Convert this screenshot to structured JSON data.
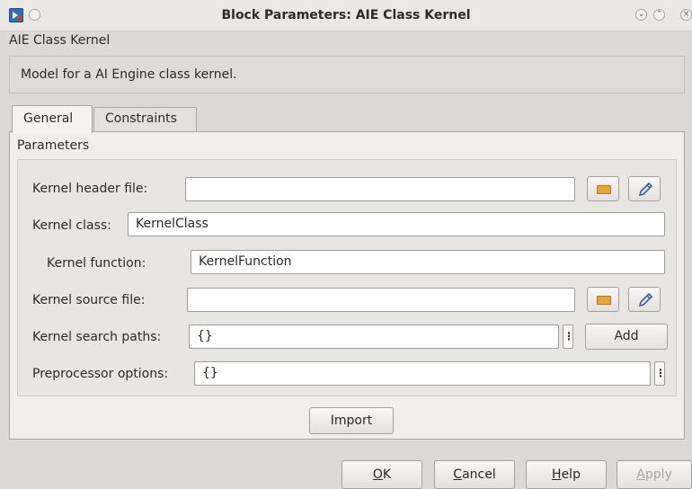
{
  "window": {
    "title": "Block Parameters: AIE Class Kernel"
  },
  "header": {
    "block_name": "AIE Class Kernel",
    "description": "Model for a AI Engine class kernel."
  },
  "tabs": [
    {
      "label": "General",
      "selected": true
    },
    {
      "label": "Constraints",
      "selected": false
    }
  ],
  "parameters": {
    "group_label": "Parameters",
    "kernel_header_file": {
      "label": "Kernel header file:",
      "value": ""
    },
    "kernel_class": {
      "label": "Kernel class:",
      "value": "KernelClass"
    },
    "kernel_function": {
      "label": "Kernel function:",
      "value": "KernelFunction"
    },
    "kernel_source_file": {
      "label": "Kernel source file:",
      "value": ""
    },
    "kernel_search_paths": {
      "label": "Kernel search paths:",
      "value": "{}"
    },
    "preprocessor_options": {
      "label": "Preprocessor options:",
      "value": "{}"
    },
    "add_label": "Add",
    "import_label": "Import",
    "more_glyph": "⋮"
  },
  "footer": {
    "ok": {
      "mnemonic": "O",
      "rest": "K"
    },
    "cancel": {
      "mnemonic": "C",
      "rest": "ancel"
    },
    "help": {
      "mnemonic": "H",
      "rest": "elp"
    },
    "apply": {
      "mnemonic": "A",
      "rest": "pply",
      "enabled": false
    }
  },
  "icons": {
    "browse": "folder-icon",
    "edit": "pencil-icon",
    "app": "simulink-block-icon"
  },
  "colors": {
    "folder": "#e8a23a",
    "background": "#dcdad7"
  }
}
